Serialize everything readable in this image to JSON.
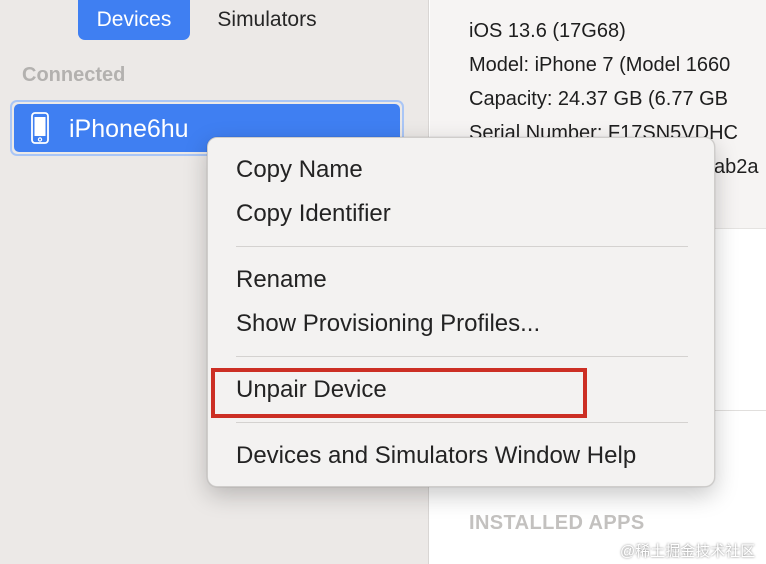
{
  "segmented": {
    "devices_label": "Devices",
    "simulators_label": "Simulators"
  },
  "sidebar": {
    "section_header": "Connected",
    "devices": [
      {
        "name": "iPhone6hu"
      }
    ]
  },
  "details": {
    "lines": [
      "iOS 13.6 (17G68)",
      "Model: iPhone 7 (Model 1660",
      "Capacity: 24.37 GB (6.77 GB",
      "Serial Number: F17SN5VDHC",
      "ab2a"
    ],
    "installed_apps_header": "INSTALLED APPS"
  },
  "context_menu": {
    "copy_name": "Copy Name",
    "copy_identifier": "Copy Identifier",
    "rename": "Rename",
    "show_provisioning_profiles": "Show Provisioning Profiles...",
    "unpair_device": "Unpair Device",
    "window_help": "Devices and Simulators Window Help"
  },
  "annotation": {
    "highlight_color": "#cc2f24",
    "highlighted_item": "Unpair Device"
  },
  "colors": {
    "accent": "#3f7ff2",
    "sidebar_bg": "#ece9e7"
  },
  "watermark": "@稀土掘金技术社区"
}
